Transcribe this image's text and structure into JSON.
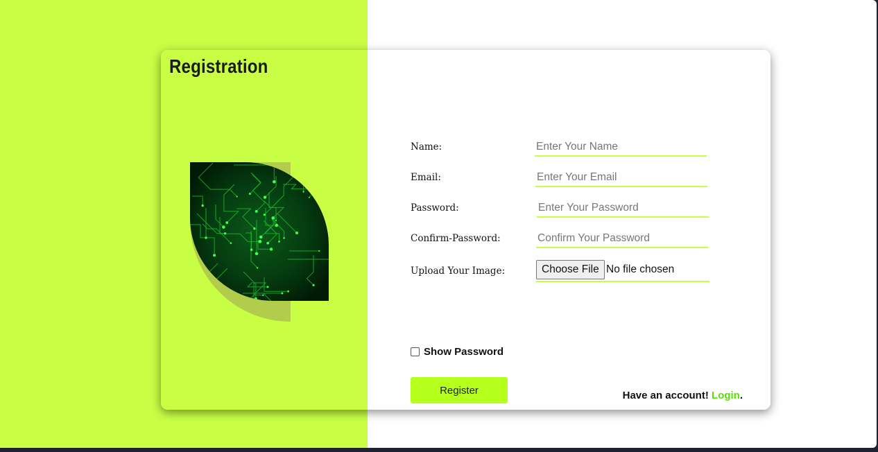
{
  "page": {
    "title": "Registration"
  },
  "form": {
    "fields": [
      {
        "label": "Name:",
        "placeholder": "Enter Your Name",
        "value": ""
      },
      {
        "label": "Email:",
        "placeholder": "Enter Your Email",
        "value": ""
      },
      {
        "label": "Password:",
        "placeholder": "Enter Your Password",
        "value": ""
      },
      {
        "label": "Confirm-Password:",
        "placeholder": "Confirm Your Password",
        "value": ""
      }
    ],
    "upload": {
      "label": "Upload Your Image:",
      "button_label": "Choose File",
      "status": "No file chosen"
    },
    "show_password": {
      "label": "Show Password",
      "checked": false
    },
    "register_label": "Register"
  },
  "footer": {
    "prompt": "Have an account!",
    "login_link": "Login",
    "suffix": "."
  },
  "icons": {
    "leaf": "circuit-leaf-icon"
  },
  "colors": {
    "accent": "#c8ff45",
    "button": "#b4ff1c",
    "link": "#5ae000",
    "leaf_shadow": "#b2cc4c",
    "leaf_dark": "#03260a",
    "circuit": "#22dd33"
  }
}
